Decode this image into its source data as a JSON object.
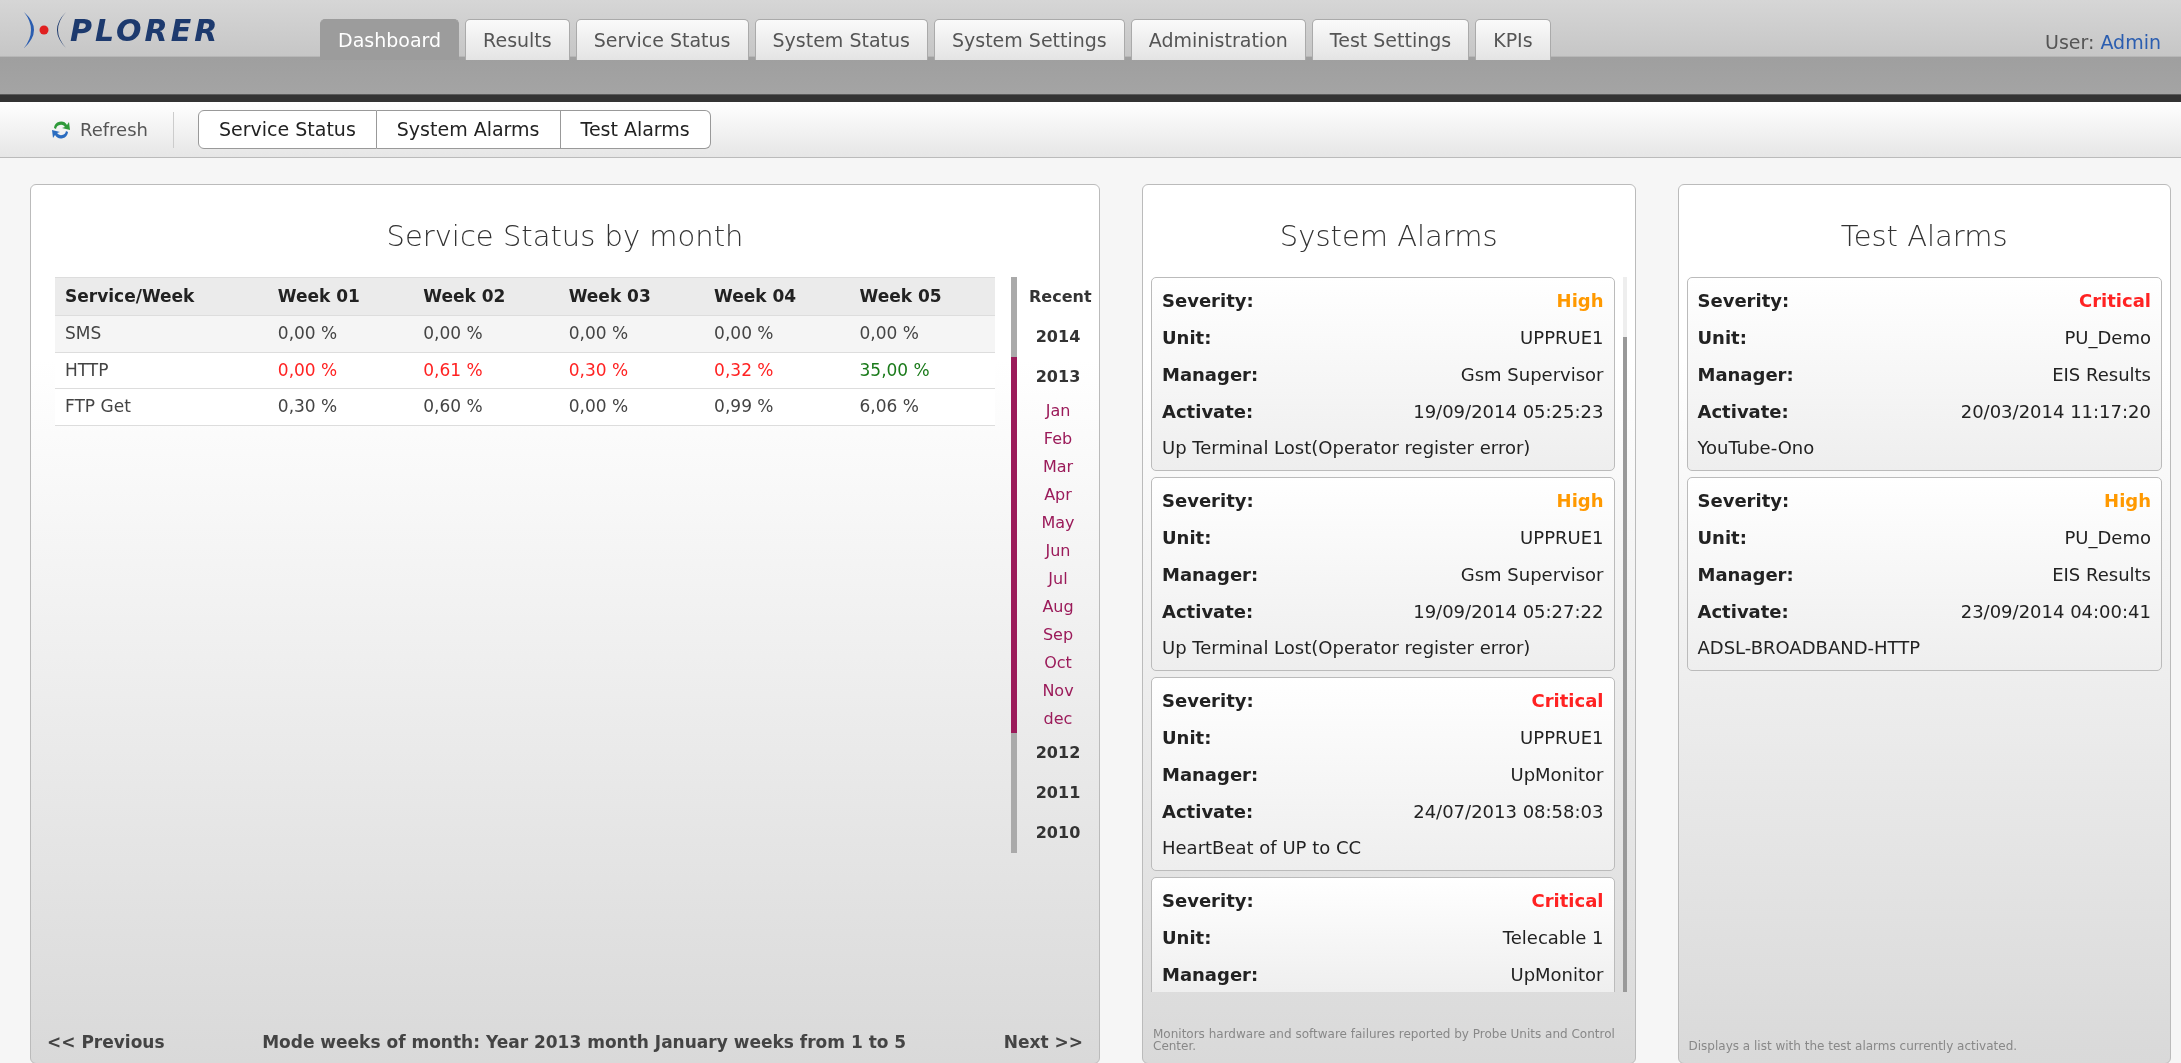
{
  "header": {
    "logo_text": "PLORER",
    "user_label": "User:",
    "user_name": "Admin"
  },
  "tabs": [
    {
      "label": "Dashboard",
      "selected": true
    },
    {
      "label": "Results",
      "selected": false
    },
    {
      "label": "Service Status",
      "selected": false
    },
    {
      "label": "System Status",
      "selected": false
    },
    {
      "label": "System Settings",
      "selected": false
    },
    {
      "label": "Administration",
      "selected": false
    },
    {
      "label": "Test Settings",
      "selected": false
    },
    {
      "label": "KPIs",
      "selected": false
    }
  ],
  "toolbar": {
    "refresh": "Refresh",
    "buttons": [
      "Service Status",
      "System Alarms",
      "Test Alarms"
    ]
  },
  "service_panel": {
    "title": "Service Status by month",
    "table": {
      "columns": [
        "Service/Week",
        "Week 01",
        "Week 02",
        "Week 03",
        "Week 04",
        "Week 05"
      ],
      "rows": [
        [
          {
            "text": "SMS"
          },
          {
            "text": "0,00 %"
          },
          {
            "text": "0,00 %"
          },
          {
            "text": "0,00 %"
          },
          {
            "text": "0,00 %"
          },
          {
            "text": "0,00 %"
          }
        ],
        [
          {
            "text": "HTTP"
          },
          {
            "text": "0,00 %",
            "color": "#ff2222"
          },
          {
            "text": "0,61 %",
            "color": "#ff2222"
          },
          {
            "text": "0,30 %",
            "color": "#ff2222"
          },
          {
            "text": "0,32 %",
            "color": "#ff2222"
          },
          {
            "text": "35,00 %",
            "color": "#1a7a1a"
          }
        ],
        [
          {
            "text": "FTP Get"
          },
          {
            "text": "0,30 %"
          },
          {
            "text": "0,60 %"
          },
          {
            "text": "0,00 %"
          },
          {
            "text": "0,99 %"
          },
          {
            "text": "6,06 %"
          }
        ]
      ]
    },
    "periods": [
      {
        "label": "Recent",
        "expanded": false
      },
      {
        "label": "2014",
        "expanded": false
      },
      {
        "label": "2013",
        "expanded": true,
        "children": [
          "Jan",
          "Feb",
          "Mar",
          "Apr",
          "May",
          "Jun",
          "Jul",
          "Aug",
          "Sep",
          "Oct",
          "Nov",
          "dec"
        ]
      },
      {
        "label": "2012",
        "expanded": false
      },
      {
        "label": "2011",
        "expanded": false
      },
      {
        "label": "2010",
        "expanded": false
      }
    ],
    "previous": "<< Previous",
    "mode": "Mode weeks of month: Year 2013 month January weeks from 1 to 5",
    "next": "Next >>"
  },
  "alarm_panels": [
    {
      "title": "System Alarms",
      "scrollbar": true,
      "cards": [
        {
          "fields": [
            {
              "label": "Severity:",
              "value": "High",
              "color": "#ff9900"
            },
            {
              "label": "Unit:",
              "value": "UPPRUE1"
            },
            {
              "label": "Manager:",
              "value": "Gsm Supervisor"
            },
            {
              "label": "Activate:",
              "value": "19/09/2014 05:25:23"
            }
          ],
          "message": "Up Terminal Lost(Operator register error)"
        },
        {
          "fields": [
            {
              "label": "Severity:",
              "value": "High",
              "color": "#ff9900"
            },
            {
              "label": "Unit:",
              "value": "UPPRUE1"
            },
            {
              "label": "Manager:",
              "value": "Gsm Supervisor"
            },
            {
              "label": "Activate:",
              "value": "19/09/2014 05:27:22"
            }
          ],
          "message": "Up Terminal Lost(Operator register error)"
        },
        {
          "fields": [
            {
              "label": "Severity:",
              "value": "Critical",
              "color": "#ff2222"
            },
            {
              "label": "Unit:",
              "value": "UPPRUE1"
            },
            {
              "label": "Manager:",
              "value": "UpMonitor"
            },
            {
              "label": "Activate:",
              "value": "24/07/2013 08:58:03"
            }
          ],
          "message": "HeartBeat of UP to CC"
        },
        {
          "fields": [
            {
              "label": "Severity:",
              "value": "Critical",
              "color": "#ff2222"
            },
            {
              "label": "Unit:",
              "value": "Telecable 1"
            },
            {
              "label": "Manager:",
              "value": "UpMonitor"
            }
          ]
        }
      ],
      "footer": "Monitors hardware and software failures reported by Probe Units and Control Center."
    },
    {
      "title": "Test Alarms",
      "scrollbar": false,
      "cards": [
        {
          "fields": [
            {
              "label": "Severity:",
              "value": "Critical",
              "color": "#ff2222"
            },
            {
              "label": "Unit:",
              "value": "PU_Demo"
            },
            {
              "label": "Manager:",
              "value": "EIS Results"
            },
            {
              "label": "Activate:",
              "value": "20/03/2014 11:17:20"
            }
          ],
          "message": "YouTube-Ono"
        },
        {
          "fields": [
            {
              "label": "Severity:",
              "value": "High",
              "color": "#ff9900"
            },
            {
              "label": "Unit:",
              "value": "PU_Demo"
            },
            {
              "label": "Manager:",
              "value": "EIS Results"
            },
            {
              "label": "Activate:",
              "value": "23/09/2014 04:00:41"
            }
          ],
          "message": "ADSL-BROADBAND-HTTP"
        }
      ],
      "footer": "Displays a list with the test alarms currently activated."
    }
  ]
}
